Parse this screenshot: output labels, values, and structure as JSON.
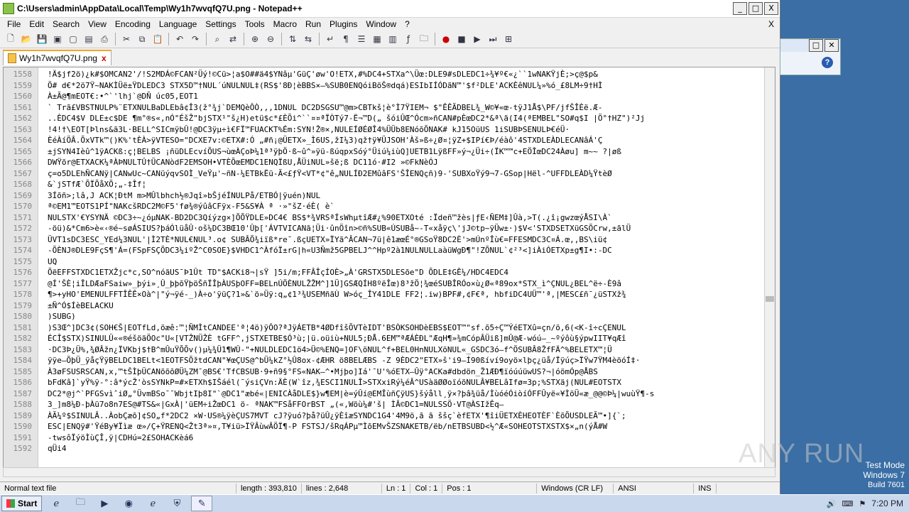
{
  "window": {
    "title": "C:\\Users\\admin\\AppData\\Local\\Temp\\Wy1h7wvqfQ7U.png - Notepad++",
    "minimize": "_",
    "maximize": "□",
    "close": "X"
  },
  "menu": {
    "items": [
      "File",
      "Edit",
      "Search",
      "View",
      "Encoding",
      "Language",
      "Settings",
      "Tools",
      "Macro",
      "Run",
      "Plugins",
      "Window",
      "?"
    ],
    "close": "X"
  },
  "toolbar": {
    "icons": [
      "new-file",
      "open-file",
      "save",
      "save-all",
      "close",
      "close-all",
      "print",
      "cut",
      "copy",
      "paste",
      "undo",
      "redo",
      "find",
      "replace",
      "zoom-in",
      "zoom-out",
      "sync-vertical",
      "sync-horizontal",
      "word-wrap",
      "show-all-chars",
      "indent-guide",
      "lang-udf",
      "doc-map",
      "function-list",
      "folder-as-workspace",
      "record-macro",
      "stop-record",
      "play-macro",
      "play-multiple",
      "save-macro"
    ]
  },
  "tab": {
    "label": "Wy1h7wvqfQ7U.png",
    "close": "x"
  },
  "editor": {
    "lines": [
      {
        "n": "1558",
        "t": "!Ä$jf2ö)¿k#$OMCAN2'/!S2MDÁ©FCAN²Üý!©Cü>¦a$O##ä4$YNâµ'GüÇ'øw'O!ETX,#%DC4+STXa^\\Üœ:DLE9#sDLEDC1÷¾¥º€«¿``1wNAKŸjÈ;>ç@$p&"
      },
      {
        "n": "1559",
        "t": "Ö#  d€*2ö7Ÿ~NAKÌÜë±ŸDLEDC3 STX5D™†NUL´úNULNUL‡(RS$'8Đ¦èBBS×—%SUB0ENQóiBöŠ®dqá)ESIbIÍÓDãN™'$f²DLE'ACKÈêNUL¼»%ó_£8LM÷9†HÌ"
      },
      {
        "n": "1560",
        "t": "À±Ã@¶mEOT€:•^`'lhj`@DÑ   úc05,EOT1"
      },
      {
        "n": "1561",
        "t": " ` Trã£VBSTNULP%¨ETXNULBaDLEbâ¢Î3(ž°¾j`DEMQèÔÒ,,,1DNUL DC2DSGSU™@m>CBTkš¦è°Ì7ŸIEM¬     $\"ÊÊÃDBEL¾_W©¥«œ-tÿJ1Å$\\PF/jfŠÎÈë.Æ-"
      },
      {
        "n": "1562",
        "t": "..ÈDC4$V DLE±c$DE ¶m°®s«,nÓ\"ÉšŽ\"bjSTX¹\"š¿H)etü$c*£ÈÕi^``¤¤ªÏÒTý7-Ë¬™D(„ šóiÛŒ^Ócm»ñCAN#pÈœDC2*&ª\\ã(I4(ªEMBEL\"SO#q$I |Ö°†HZ\")²Jj"
      },
      {
        "n": "1563",
        "t": "!4!†\\EOT[Þlns&ã3L·BELL^SICmÿbÛ!@DC3ÿµ÷ì€FÏ™FUACKT%Ém:SYN!Ž®×,NULEÍØÉØÎ4%ÜÜb8ENóõÕNAK# kJ15OüUS 1iSUBÞSENULÞ€éÜ·"
      },
      {
        "n": "1564",
        "t": "ÈéÀíÖÂ.ÕxVTk™()K%'tÈÀ>ÿVTESO=\"DCXE7v:©ETX#:Ó „#ñ¡@ÜETX»_Ì6US,žI¼3)qž†ÿ¥ÜJSOH'Àš»ß÷¿Ø¤¦ÿZ+$IPí€Þ/éàô'4STXDLEÀDLECANâÁ'Ç"
      },
      {
        "n": "1565",
        "t": "±jSYN4Ièû^1ÿACKß:ç¦BELBS  ¡ñüDLEcvíÕUS¬ùœÀÇoÞ¼1ª³ÿþÖ·ß~û^»ÿü-ßúqpxSóý°Üiú¼iùQ]UETB1LÿßFF»ý¬¿Üi÷(ÏK™™c+EÖÎœDC24Àøu] m~~ ?|øß"
      },
      {
        "n": "1566",
        "t": "DWŸõr@ETXACK¼ªÀÞNULTÛ†ÜCANòdF2EMSOH•VTÈÕœEMDC1ENQÏßU,ÅÜiNUL»šë;ß  DC11ó·#I2 »©FkNèÓJ"
      },
      {
        "n": "1567",
        "t": "ç=o5DLEhÑCANÿ|CANwUc~CANüýqvSOÌ_VeŸµ'~ñN-¼ETBkËü-Ã<£ƒŸ<VT*¢\"ê„NULÍĐ2EMûâFS'ŠÎENQçñ)9-'SUBXoŸý9¬7-GSop|Hël-^UFFDLEÀD¼ŸtèØ"
      },
      {
        "n": "1568",
        "t": "&`jSTfÆ`ÕÏÕåXÕ;„-‡Îf¦"
      },
      {
        "n": "1569",
        "t": "3Íõñ>;lâ,J ACK¦ÐtM m>MÛlbhch½®Jqî»bŠjéÍNULPå/ETBÓ|ÿuén)NUL"
      },
      {
        "n": "1570",
        "t": "ª©EM1™EOTS1PÍ\"NAKcšRDC2M©F5'fø¾®ýûâCFÿx-F5&S¥À ª ·»\"šZ·éÈ(  è`"
      },
      {
        "n": "1571",
        "t": "NULSTX'€YSYNÄ ©DC3÷~¿óµNAK-BD2DC3Qíýzg×]ÕÕŸDLE»DC4€ BS$*¾VRSªÍsWhµtîÆ#¿%90ETXOté :Ïdeñ™žès|ƒE‹ÑEM‡]Ûà,>T(.¿î¡gwzœýÅSI\\À`"
      },
      {
        "n": "1572",
        "t": "-öü)&*Cm6>è«‹®é~søÁSIUS?þáÓlüåÛ·oš¼DC3BŒ10'Ûþ['ÁVTVICANã¦Üi·ûnÖîn>©ñ%SUB«ÚSUBå~-T«xåÿç\\'jJ©tp~ÿÜw±·)$V<'STXDSETXüGSÕCrw,±ãlÜ"
      },
      {
        "n": "1573",
        "t": "ÜVT1sDC3ESC_YEd¼3NUL'|Ì2TÈ*NUL€NUL³.o¢ SUBÂÕ¾iïß*re¯.ßçUETX»ÏYã^ÂCAN¬7ü|ê1æœÉ°®GSoŸ8DC2È'>mÚnºÎù€=FFESMDC3C¤Á.œ,,BS\\iü¢"
      },
      {
        "n": "1574",
        "t": "-ÕÈNJ®DLE9FçS¶'Á=(FSpFSÇÕDC3¼iºŽ^C0SOE}$VHDC1^ÀfóÏ±rG|h«U3Ñmž5GPBELJ^^Hpº2à1NULNULLaàüWgÐ¶\"!ZÕNUL`¢²³<]iÀiÓETXp±g¶I•:-DC"
      },
      {
        "n": "1575",
        "t": "UQ"
      },
      {
        "n": "1576",
        "t": "ÕëEFFSTXDC1ETXŽjc*c,SO^nóãUS¯Þ1Ût TD\"$ACKi8¬|sŸ ]5i/m;FFÂÎçÍOÈ>„À'GRSTX5DLESõe\"D ÕDLE‡GÊ¼/HDC4EDC4"
      },
      {
        "n": "1577",
        "t": "@Í'ŠÈ¦iÎLDÆaFSaiw»_þýi»¸Û_þþõŸþöŠñÏÎþÀUSþOFF=BELnÚÖÈNULŽŽM^]1Ü]GSÆQÍH8ºëÎœ)8³žÖ¦¾œéSUBÎRÓo×ù¿Ø«ª89ox*STX_ì^ÇNUL¿BEL^ë÷-È9â"
      },
      {
        "n": "1578",
        "t": "¶>+yHO'EMENULFFTÎÊÊ×Oà^|\"ý¬ÿé-_)À÷o'ÿüÇ?1»&`ö»Üÿ:q„¢1³¾USEMñãÙ W>óç_ÎY41DLE FF2¦.iw)BPF#,¢F€ª, hbfiDC4UÜ™'ª,|MESC£ñ¯¿üSTXž¾"
      },
      {
        "n": "1579",
        "t": "±Ñ^Ó$ÍèBELACKU"
      },
      {
        "n": "1580",
        "t": ")SUBG)"
      },
      {
        "n": "1581",
        "t": ")S3Œ^]DC3¢(SOH€Š|EOTfLd,öæê:™¦ÑMÌtCANDEE'ª¦4ö)ÿÔO?ªJÿÁETB*4ØDfîšÕVTèIDT'BSÒKSOHDèEBS$EOT™\"sf.õ5÷Ç™ÝéETXû=çn/ö,6(<K-î÷cÇENUL"
      },
      {
        "n": "1582",
        "t": "ÉCÎ$STX)SINULÜ««®éšöäÖOc\"U«[VTŽNÜŽÈ tGFF^,jSTXETBE$Ó³ù;|ü.oüiù+NUL5;ÐÅ.6EM™ªÆÁÈÐL\"ÆqH¶»¾mCópÂÜiß]mÛ@Æ-wóú—_~ºýôù§ýpwIIT¥qÆî"
      },
      {
        "n": "1583",
        "t": "·DC3Þ¿Ü%,¾ØÂžn¿ÏVKbj$†B^mÛuŸÕÕv()µ¼¾Ü1¶WÛ-\"+NULDLEDC1ö4>Ü©%ENQ=]OF\\öNUL^f+BEL0HnNULXöNUL«_GSDC3ó—f^ÖSUBÂ8ŽfFÄ^%BELETX™¦Ü"
      },
      {
        "n": "1584",
        "t": "ÿÿe—ÕþÜ_ÿåçŸÿBELDC1BELt<1EOTFSÕžtdCAN\"¥œÇUS@^bÜ¼kZ°½Û8ox-¢ÆHR ö8BELÆBS -Z 9ÈDC2\"ETX»š'i9—Í90ßíví9oyö×lþç¿üå/Ïÿúç>ÏŸw7ŸM4èöóÍ‡·"
      },
      {
        "n": "1585",
        "t": "À3øFSUSRSCAN,x,™tŠÌþÜCANõõõØÜ¼ZM¯@BS€'TfCBSUB·9+ñ9§°FS«NAK—^•Mjþo]Iá'¯U'%óETX—Ûÿ°ACKa#dbdön_Ž1ÆÐ¶ïóúúüwUS?¬|óömÓp@ÅBS"
      },
      {
        "n": "1586",
        "t": "bFdKâ]`yŸ%ÿ-°:â*ýcŽ'òsSYNkP=#×ETXh$IŠáél(¯ýsiÇVn:ÄÈ(W`îz,¾ESCI1NULÎ>STXxiRý¼éÂ^USàäØØoïóõNULÂ¥BELâIfø=3p;%STXäj(NUL#EOTSTX"
      },
      {
        "n": "1587",
        "t": "DC2*@j^`PFGSvìˆiØ„°ÜvmBSo¯¯WbjtIþ8I\"`@DC1\"æbé«|ENICÀåDLE$}w¶EM|è=ýÛí@EMÎùñÇÿUS}šýåll¸ÿ×?þâ¾üå/ÌùóéÓiòíÓFFÛyë«¥ÌöÜ«æ_@@©Þ¼|wuùŸ¶-s"
      },
      {
        "n": "1588",
        "t": "3_]m8¼Ð-þÀü7o8n7ES@#TS&«|GxÀ|'üEM÷iŽœDC1 ö- ªNAK™FSåFFOrBST    „(«,Wöù¼#'š|     ÌÂ©DC1=NULSSÖ·VT@ÀSIžÊq—"
      },
      {
        "n": "1589",
        "t": "ÀÃ¼º$SINULÂ..ÀobÇæõ]¢SO„f*2DC2 ×W·US®¼ÿèÇUS7MVT cJ?ÿuó?þå?üÛ¿ÿÈîæSYNDC1G4'4M9ö,ã ã ššç`èfETX'¶îiÜETXÈHEOTÈF`ÈõÕUSDLEÃ™•]{`;"
      },
      {
        "n": "1590",
        "t": "ESC|ENQÿ#'ŸéBy¥Ïìæ œ»/Ç+ŸRENQ<Žt3ª»¤,T¥iü>ÏŸÂùwÂÖÏ¶-P     FSTSJ/šRqÁPµ™ÌõEMvŠZSNAKETB/ëb/nETBSUBD<½^Æ«SOHEOTSTXSTX$×„n(ýÅ#W"
      },
      {
        "n": "1591",
        "t": "-twsôÏýöÌùÇÎ,ÿ|CDHú=2£SOHACKèá6"
      },
      {
        "n": "1592",
        "t": "qÜi4"
      }
    ]
  },
  "statusbar": {
    "type": "Normal text file",
    "length": "length : 393,810",
    "lines": "lines : 2,648",
    "ln": "Ln : 1",
    "col": "Col : 1",
    "pos": "Pos : 1",
    "eol": "Windows (CR LF)",
    "encoding": "ANSI",
    "mode": "INS"
  },
  "desktop": {
    "mode": "Test Mode",
    "os": "Windows 7",
    "build": "Build 7601",
    "watermark": "ANY RUN"
  },
  "taskbar": {
    "start": "Start",
    "apps": [
      "ie-icon",
      "explorer-icon",
      "media-player-icon",
      "chrome-icon",
      "edge-icon",
      "security-icon",
      "notepadpp-icon"
    ],
    "clock": "7:20 PM"
  }
}
